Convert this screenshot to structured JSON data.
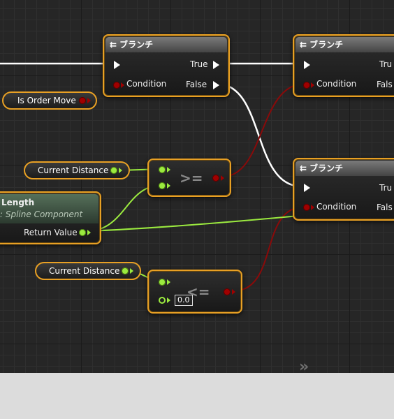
{
  "branch_title": "ブランチ",
  "branch_icon": "branch-icon",
  "pins": {
    "true": "True",
    "false": "False",
    "condition": "Condition",
    "true_truncated": "Tru",
    "false_truncated": "Fals"
  },
  "variables": {
    "is_order_move": "Is Order Move",
    "current_distance_1": "Current Distance",
    "current_distance_2": "Current Distance"
  },
  "function_node": {
    "title": "Length",
    "subtitle": ": Spline Component",
    "return_value": "Return Value"
  },
  "operators": {
    "gte": ">=",
    "lte": "<="
  },
  "literal_value": "0.0",
  "watermark": "»",
  "colors": {
    "node_border": "#e8a024",
    "exec_wire": "#ffffff",
    "bool_pin": "#a00000",
    "float_pin": "#9bea3f",
    "graph_bg": "#262626"
  }
}
